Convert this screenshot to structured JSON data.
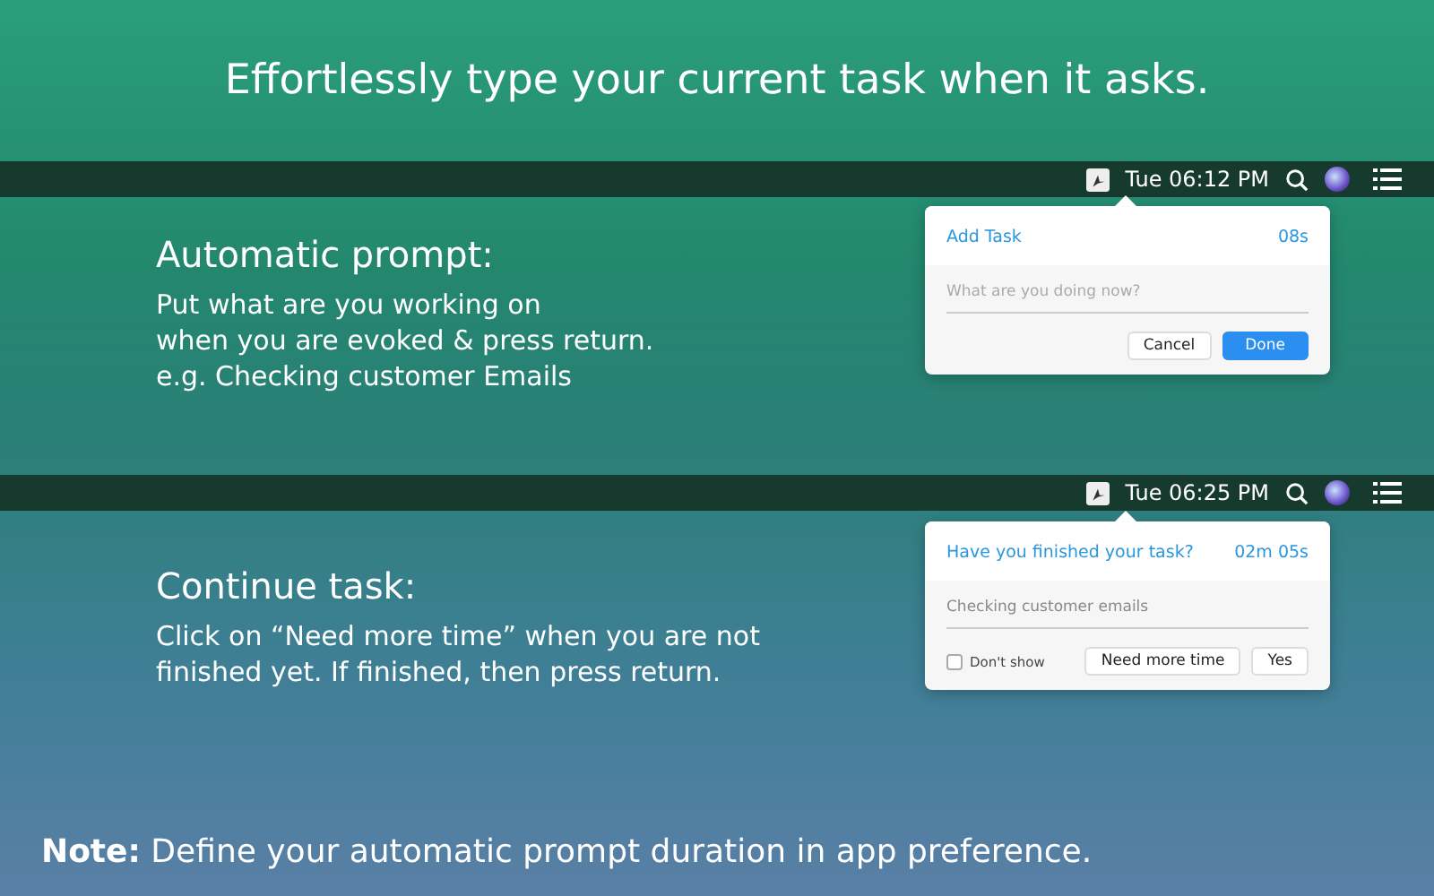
{
  "headline": "Effortlessly type your current task when it asks.",
  "sections": [
    {
      "clock": "Tue 06:12 PM",
      "heading": "Automatic prompt:",
      "body": "Put what are you working on\nwhen you are evoked & press return.\ne.g. Checking customer Emails",
      "popover": {
        "title": "Add Task",
        "timer": "08s",
        "field": {
          "placeholder": "What are you doing now?"
        },
        "buttons": [
          {
            "label": "Cancel",
            "primary": false
          },
          {
            "label": "Done",
            "primary": true
          }
        ]
      }
    },
    {
      "clock": "Tue 06:25 PM",
      "heading": "Continue task:",
      "body": "Click on “Need more time” when you are not\nfinished yet. If finished, then press return.",
      "popover": {
        "title": "Have you finished your task?",
        "timer": "02m 05s",
        "field": {
          "value": "Checking customer emails"
        },
        "checkbox": {
          "label": "Don't show",
          "checked": false
        },
        "buttons": [
          {
            "label": "Need more time",
            "primary": false
          },
          {
            "label": "Yes",
            "primary": false
          }
        ]
      }
    }
  ],
  "note": "**Note:** Define your automatic prompt duration in app preference."
}
